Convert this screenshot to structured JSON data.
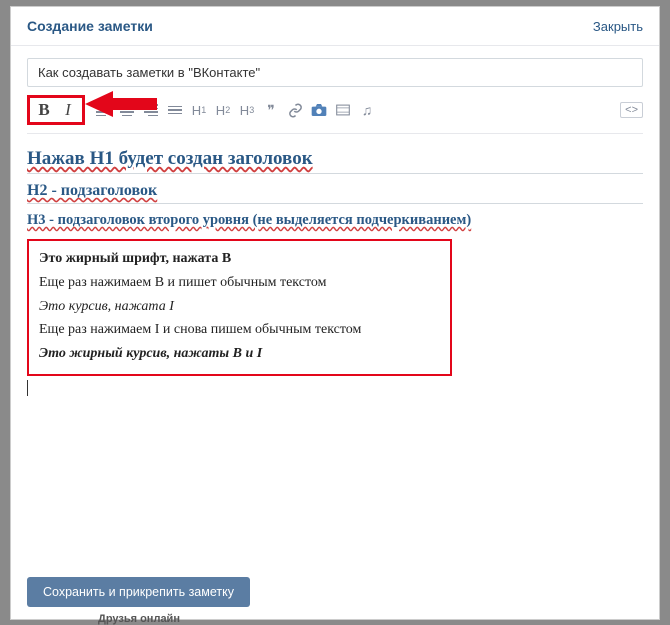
{
  "header": {
    "title": "Создание заметки",
    "close": "Закрыть"
  },
  "input": {
    "value": "Как создавать заметки в \"ВКонтакте\""
  },
  "toolbar": {
    "bold": "B",
    "italic": "I",
    "h1": "H",
    "h2": "H",
    "h3": "H",
    "quote": "❞",
    "link": "🔗",
    "camera": "📷",
    "video": "▦",
    "audio": "♫",
    "code": "<>"
  },
  "content": {
    "h1": "Нажав H1 будет создан заголовок",
    "h2": "H2 - подзаголовок",
    "h3": "H3 - подзаголовок второго уровня (не выделяется подчеркиванием)",
    "line1": "Это жирный шрифт, нажата B",
    "line2": "Еще раз нажимаем B и пишет обычным текстом",
    "line3": "Это курсив, нажата I",
    "line4": "Еще раз нажимаем I и снова пишем обычным текстом",
    "line5": "Это жирный курсив, нажаты B и I"
  },
  "footer": {
    "save": "Сохранить и прикрепить заметку"
  },
  "bg": {
    "friends": "Друзья онлайн"
  }
}
